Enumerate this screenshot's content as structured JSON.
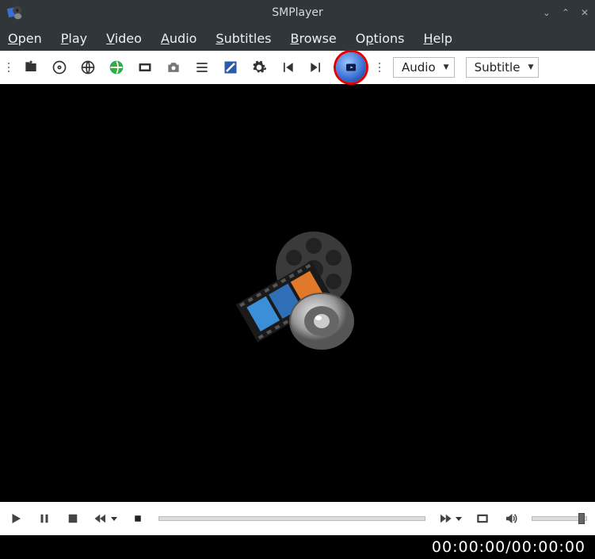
{
  "window": {
    "title": "SMPlayer"
  },
  "menu": {
    "open": {
      "label": "Open",
      "accel_index": 0
    },
    "play": {
      "label": "Play",
      "accel_index": 0
    },
    "video": {
      "label": "Video",
      "accel_index": 0
    },
    "audio": {
      "label": "Audio",
      "accel_index": 0
    },
    "subtitles": {
      "label": "Subtitles",
      "accel_index": 0
    },
    "browse": {
      "label": "Browse",
      "accel_index": 0
    },
    "options": {
      "label": "Options",
      "accel_index": 0
    },
    "help": {
      "label": "Help",
      "accel_index": 0
    }
  },
  "toolbar_combo": {
    "audio_label": "Audio",
    "subtitle_label": "Subtitle"
  },
  "status": {
    "position": "00:00:00",
    "separator": " / ",
    "duration": "00:00:00"
  },
  "highlight": {
    "target": "youtube-browser-button"
  }
}
